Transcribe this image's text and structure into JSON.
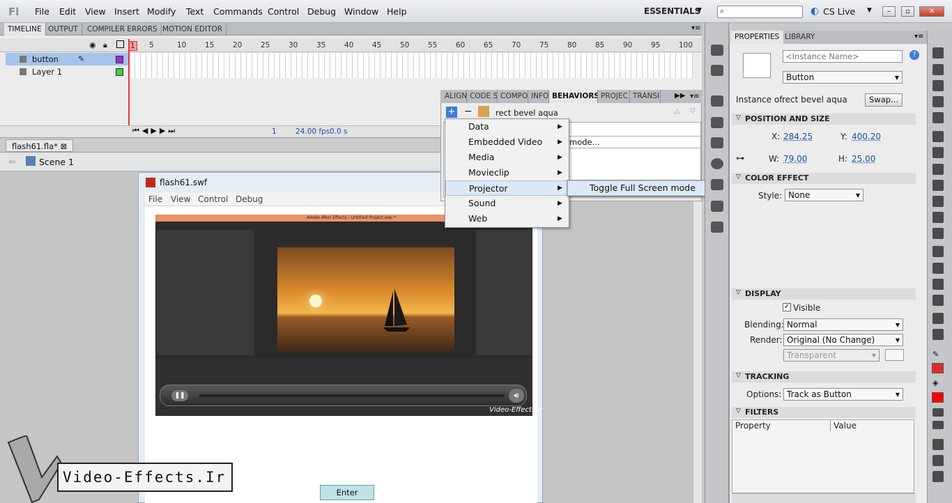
{
  "app": {
    "logo": "Fl",
    "workspace": "ESSENTIALS",
    "cslive": "CS Live"
  },
  "menu": [
    "File",
    "Edit",
    "View",
    "Insert",
    "Modify",
    "Text",
    "Commands",
    "Control",
    "Debug",
    "Window",
    "Help"
  ],
  "panel_tabs": [
    "TIMELINE",
    "OUTPUT",
    "COMPILER ERRORS",
    "MOTION EDITOR"
  ],
  "timeline": {
    "layers": [
      {
        "name": "button"
      },
      {
        "name": "Layer 1"
      }
    ],
    "frame_numbers": [
      "1",
      "5",
      "10",
      "15",
      "20",
      "25",
      "30",
      "35",
      "40",
      "45",
      "50",
      "55",
      "60",
      "65",
      "70",
      "75",
      "80",
      "85",
      "90",
      "95",
      "100"
    ],
    "current_frame": "1",
    "fps": "24.00 fps",
    "time": "0.0 s"
  },
  "document": {
    "tab": "flash61.fla*",
    "scene": "Scene 1"
  },
  "swf": {
    "title": "flash61.swf",
    "menu": [
      "File",
      "View",
      "Control",
      "Debug"
    ],
    "enter_label": "Enter",
    "ae_title": "Adobe After Effects - Untitled Project.aep *",
    "ae_watermark": "Video-Effects.Ir"
  },
  "watermark": {
    "text": "Video-Effects.Ir"
  },
  "behaviors": {
    "tabs": [
      "ALIGN",
      "CODE SI",
      "COMPO",
      "INFO",
      "BEHAVIORS",
      "PROJEC",
      "TRANSI"
    ],
    "instance": "rect bevel aqua",
    "row_text": "mode...",
    "menu": [
      "Data",
      "Embedded Video",
      "Media",
      "Movieclip",
      "Projector",
      "Sound",
      "Web"
    ],
    "highlighted": "Projector",
    "submenu": [
      "Toggle Full Screen mode"
    ]
  },
  "properties": {
    "tabs": [
      "PROPERTIES",
      "LIBRARY"
    ],
    "instance_name_placeholder": "<Instance Name>",
    "symbol_type": "Button",
    "instance_of_label": "Instance of:",
    "instance_of": "rect bevel aqua",
    "swap_label": "Swap...",
    "position": {
      "title": "POSITION AND SIZE",
      "x_label": "X:",
      "x": "284.25",
      "y_label": "Y:",
      "y": "400.20",
      "w_label": "W:",
      "w": "79.00",
      "h_label": "H:",
      "h": "25.00"
    },
    "color": {
      "title": "COLOR EFFECT",
      "style_label": "Style:",
      "style": "None"
    },
    "display": {
      "title": "DISPLAY",
      "visible_label": "Visible",
      "blending_label": "Blending:",
      "blending": "Normal",
      "render_label": "Render:",
      "render": "Original (No Change)",
      "bg": "Transparent"
    },
    "tracking": {
      "title": "TRACKING",
      "options_label": "Options:",
      "options": "Track as Button"
    },
    "filters": {
      "title": "FILTERS",
      "col_property": "Property",
      "col_value": "Value"
    }
  }
}
